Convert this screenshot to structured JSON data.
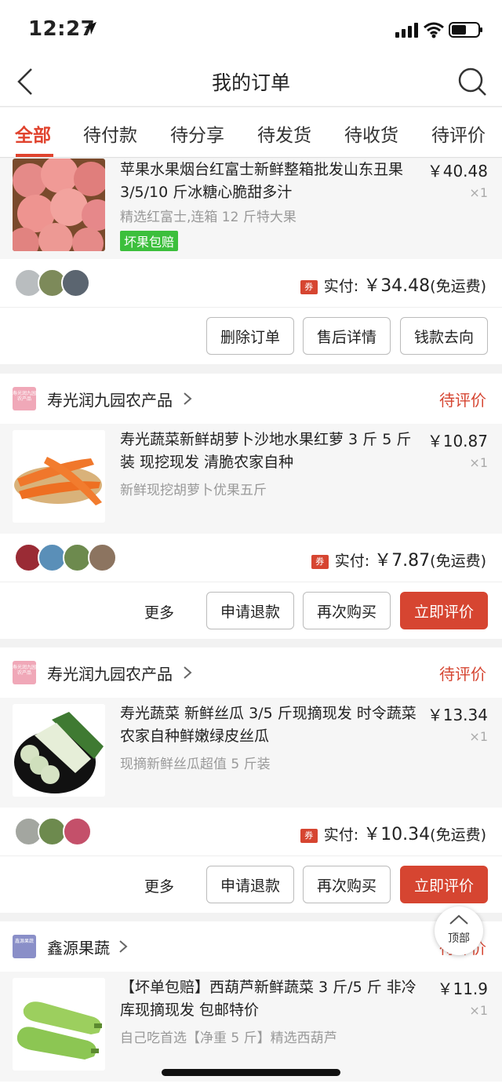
{
  "status": {
    "time": "12:27"
  },
  "header": {
    "title": "我的订单"
  },
  "tabs": [
    {
      "label": "全部"
    },
    {
      "label": "待付款"
    },
    {
      "label": "待分享"
    },
    {
      "label": "待发货"
    },
    {
      "label": "待收货"
    },
    {
      "label": "待评价"
    }
  ],
  "orders": [
    {
      "product": {
        "title": "苹果水果烟台红富士新鲜整箱批发山东丑果 3/5/10 斤冰糖心脆甜多汁",
        "subtitle": "精选红富士,连箱 12 斤特大果",
        "tag": "坏果包赔",
        "price": "￥40.48",
        "qty": "×1"
      },
      "payment": {
        "coupon": "券",
        "label": "实付:",
        "amount": "￥34.48",
        "note": "(免运费)"
      },
      "buttons": [
        "删除订单",
        "售后详情",
        "钱款去向"
      ]
    },
    {
      "store": {
        "name": "寿光润九园农产品",
        "status": "待评价",
        "logo_text": "寿光润九园农产品"
      },
      "product": {
        "title": "寿光蔬菜新鲜胡萝卜沙地水果红萝 3 斤 5 斤装 现挖现发 清脆农家自种",
        "subtitle": "新鲜现挖胡萝卜优果五斤",
        "price": "￥10.87",
        "qty": "×1"
      },
      "payment": {
        "coupon": "券",
        "label": "实付:",
        "amount": "￥7.87",
        "note": "(免运费)"
      },
      "more": "更多",
      "buttons": [
        "申请退款",
        "再次购买",
        "立即评价"
      ]
    },
    {
      "store": {
        "name": "寿光润九园农产品",
        "status": "待评价",
        "logo_text": "寿光润九园农产品"
      },
      "product": {
        "title": "寿光蔬菜 新鲜丝瓜 3/5 斤现摘现发 时令蔬菜农家自种鲜嫩绿皮丝瓜",
        "subtitle": "现摘新鲜丝瓜超值 5 斤装",
        "price": "￥13.34",
        "qty": "×1"
      },
      "payment": {
        "coupon": "券",
        "label": "实付:",
        "amount": "￥10.34",
        "note": "(免运费)"
      },
      "more": "更多",
      "buttons": [
        "申请退款",
        "再次购买",
        "立即评价"
      ]
    },
    {
      "store": {
        "name": "鑫源果蔬",
        "status": "待评价",
        "logo_text": "鑫源果蔬"
      },
      "product": {
        "title": "【坏单包赔】西葫芦新鲜蔬菜 3 斤/5 斤 非冷库现摘现发 包邮特价",
        "subtitle": "自己吃首选【净重 5 斤】精选西葫芦",
        "price": "￥11.9",
        "qty": "×1"
      }
    }
  ],
  "floating": {
    "top_label": "顶部"
  },
  "colors": {
    "accent": "#d64531",
    "tag_green": "#3cbf3c"
  }
}
